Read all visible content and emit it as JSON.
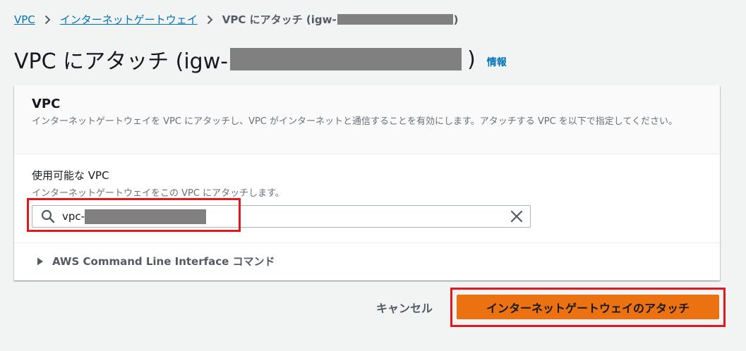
{
  "breadcrumb": {
    "vpc_label": "VPC",
    "igw_label": "インターネットゲートウェイ",
    "current_prefix": "VPC にアタッチ (igw-",
    "current_suffix": ")"
  },
  "page": {
    "title_prefix": "VPC にアタッチ (igw-",
    "title_suffix": ")",
    "info_link": "情報"
  },
  "panel": {
    "title": "VPC",
    "description": "インターネットゲートウェイを VPC にアタッチし、VPC がインターネットと通信することを有効にします。アタッチする VPC を以下で指定してください。",
    "field_label": "使用可能な VPC",
    "field_description": "インターネットゲートウェイをこの VPC にアタッチします。",
    "search_value_prefix": "vpc-",
    "cli_expander": "AWS Command Line Interface コマンド"
  },
  "actions": {
    "cancel": "キャンセル",
    "attach": "インターネットゲートウェイのアタッチ"
  },
  "colors": {
    "link": "#0073bb",
    "primary_button": "#ec7211",
    "highlight": "#e1191f",
    "redaction": "#808080"
  },
  "icons": {
    "crumb_separator": "chevron-right-icon",
    "search": "search-icon",
    "clear": "close-icon",
    "expander": "caret-right-icon"
  }
}
